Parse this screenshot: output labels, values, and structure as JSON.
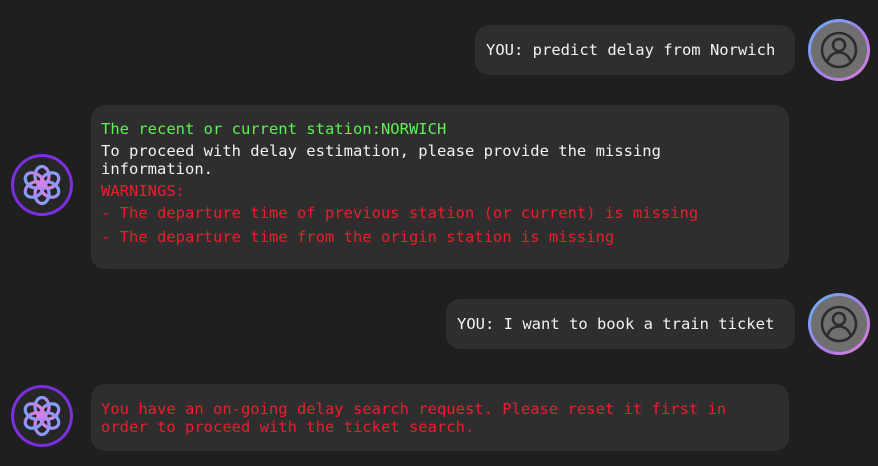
{
  "messages": [
    {
      "role": "user",
      "text": "YOU: predict delay from Norwich"
    },
    {
      "role": "bot",
      "station_line": "The recent or current station:NORWICH",
      "info_line": "To proceed with delay estimation, please provide the missing information.",
      "warnings_label": "WARNINGS:",
      "warnings": [
        "- The departure time of previous station (or current) is missing",
        "- The departure time from the origin station is missing"
      ]
    },
    {
      "role": "user",
      "text": "YOU: I want to book a train ticket"
    },
    {
      "role": "bot",
      "error_line": "You have an on-going delay search request. Please reset it first in order to proceed with the ticket search."
    }
  ],
  "icons": {
    "user_avatar": "user-avatar-icon",
    "bot_avatar": "chatbot-logo-icon"
  },
  "colors": {
    "background": "#1f1f1f",
    "bubble": "#2e2e2e",
    "station_text": "#5cf253",
    "warning_text": "#ef1c2c",
    "bot_ring": "#7c2fe0"
  }
}
